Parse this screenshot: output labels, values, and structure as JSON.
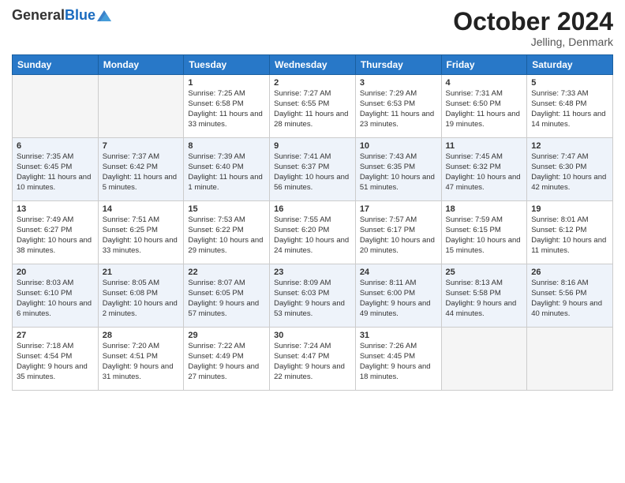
{
  "header": {
    "logo_general": "General",
    "logo_blue": "Blue",
    "month_title": "October 2024",
    "location": "Jelling, Denmark"
  },
  "weekdays": [
    "Sunday",
    "Monday",
    "Tuesday",
    "Wednesday",
    "Thursday",
    "Friday",
    "Saturday"
  ],
  "weeks": [
    [
      {
        "day": "",
        "sunrise": "",
        "sunset": "",
        "daylight": ""
      },
      {
        "day": "",
        "sunrise": "",
        "sunset": "",
        "daylight": ""
      },
      {
        "day": "1",
        "sunrise": "Sunrise: 7:25 AM",
        "sunset": "Sunset: 6:58 PM",
        "daylight": "Daylight: 11 hours and 33 minutes."
      },
      {
        "day": "2",
        "sunrise": "Sunrise: 7:27 AM",
        "sunset": "Sunset: 6:55 PM",
        "daylight": "Daylight: 11 hours and 28 minutes."
      },
      {
        "day": "3",
        "sunrise": "Sunrise: 7:29 AM",
        "sunset": "Sunset: 6:53 PM",
        "daylight": "Daylight: 11 hours and 23 minutes."
      },
      {
        "day": "4",
        "sunrise": "Sunrise: 7:31 AM",
        "sunset": "Sunset: 6:50 PM",
        "daylight": "Daylight: 11 hours and 19 minutes."
      },
      {
        "day": "5",
        "sunrise": "Sunrise: 7:33 AM",
        "sunset": "Sunset: 6:48 PM",
        "daylight": "Daylight: 11 hours and 14 minutes."
      }
    ],
    [
      {
        "day": "6",
        "sunrise": "Sunrise: 7:35 AM",
        "sunset": "Sunset: 6:45 PM",
        "daylight": "Daylight: 11 hours and 10 minutes."
      },
      {
        "day": "7",
        "sunrise": "Sunrise: 7:37 AM",
        "sunset": "Sunset: 6:42 PM",
        "daylight": "Daylight: 11 hours and 5 minutes."
      },
      {
        "day": "8",
        "sunrise": "Sunrise: 7:39 AM",
        "sunset": "Sunset: 6:40 PM",
        "daylight": "Daylight: 11 hours and 1 minute."
      },
      {
        "day": "9",
        "sunrise": "Sunrise: 7:41 AM",
        "sunset": "Sunset: 6:37 PM",
        "daylight": "Daylight: 10 hours and 56 minutes."
      },
      {
        "day": "10",
        "sunrise": "Sunrise: 7:43 AM",
        "sunset": "Sunset: 6:35 PM",
        "daylight": "Daylight: 10 hours and 51 minutes."
      },
      {
        "day": "11",
        "sunrise": "Sunrise: 7:45 AM",
        "sunset": "Sunset: 6:32 PM",
        "daylight": "Daylight: 10 hours and 47 minutes."
      },
      {
        "day": "12",
        "sunrise": "Sunrise: 7:47 AM",
        "sunset": "Sunset: 6:30 PM",
        "daylight": "Daylight: 10 hours and 42 minutes."
      }
    ],
    [
      {
        "day": "13",
        "sunrise": "Sunrise: 7:49 AM",
        "sunset": "Sunset: 6:27 PM",
        "daylight": "Daylight: 10 hours and 38 minutes."
      },
      {
        "day": "14",
        "sunrise": "Sunrise: 7:51 AM",
        "sunset": "Sunset: 6:25 PM",
        "daylight": "Daylight: 10 hours and 33 minutes."
      },
      {
        "day": "15",
        "sunrise": "Sunrise: 7:53 AM",
        "sunset": "Sunset: 6:22 PM",
        "daylight": "Daylight: 10 hours and 29 minutes."
      },
      {
        "day": "16",
        "sunrise": "Sunrise: 7:55 AM",
        "sunset": "Sunset: 6:20 PM",
        "daylight": "Daylight: 10 hours and 24 minutes."
      },
      {
        "day": "17",
        "sunrise": "Sunrise: 7:57 AM",
        "sunset": "Sunset: 6:17 PM",
        "daylight": "Daylight: 10 hours and 20 minutes."
      },
      {
        "day": "18",
        "sunrise": "Sunrise: 7:59 AM",
        "sunset": "Sunset: 6:15 PM",
        "daylight": "Daylight: 10 hours and 15 minutes."
      },
      {
        "day": "19",
        "sunrise": "Sunrise: 8:01 AM",
        "sunset": "Sunset: 6:12 PM",
        "daylight": "Daylight: 10 hours and 11 minutes."
      }
    ],
    [
      {
        "day": "20",
        "sunrise": "Sunrise: 8:03 AM",
        "sunset": "Sunset: 6:10 PM",
        "daylight": "Daylight: 10 hours and 6 minutes."
      },
      {
        "day": "21",
        "sunrise": "Sunrise: 8:05 AM",
        "sunset": "Sunset: 6:08 PM",
        "daylight": "Daylight: 10 hours and 2 minutes."
      },
      {
        "day": "22",
        "sunrise": "Sunrise: 8:07 AM",
        "sunset": "Sunset: 6:05 PM",
        "daylight": "Daylight: 9 hours and 57 minutes."
      },
      {
        "day": "23",
        "sunrise": "Sunrise: 8:09 AM",
        "sunset": "Sunset: 6:03 PM",
        "daylight": "Daylight: 9 hours and 53 minutes."
      },
      {
        "day": "24",
        "sunrise": "Sunrise: 8:11 AM",
        "sunset": "Sunset: 6:00 PM",
        "daylight": "Daylight: 9 hours and 49 minutes."
      },
      {
        "day": "25",
        "sunrise": "Sunrise: 8:13 AM",
        "sunset": "Sunset: 5:58 PM",
        "daylight": "Daylight: 9 hours and 44 minutes."
      },
      {
        "day": "26",
        "sunrise": "Sunrise: 8:16 AM",
        "sunset": "Sunset: 5:56 PM",
        "daylight": "Daylight: 9 hours and 40 minutes."
      }
    ],
    [
      {
        "day": "27",
        "sunrise": "Sunrise: 7:18 AM",
        "sunset": "Sunset: 4:54 PM",
        "daylight": "Daylight: 9 hours and 35 minutes."
      },
      {
        "day": "28",
        "sunrise": "Sunrise: 7:20 AM",
        "sunset": "Sunset: 4:51 PM",
        "daylight": "Daylight: 9 hours and 31 minutes."
      },
      {
        "day": "29",
        "sunrise": "Sunrise: 7:22 AM",
        "sunset": "Sunset: 4:49 PM",
        "daylight": "Daylight: 9 hours and 27 minutes."
      },
      {
        "day": "30",
        "sunrise": "Sunrise: 7:24 AM",
        "sunset": "Sunset: 4:47 PM",
        "daylight": "Daylight: 9 hours and 22 minutes."
      },
      {
        "day": "31",
        "sunrise": "Sunrise: 7:26 AM",
        "sunset": "Sunset: 4:45 PM",
        "daylight": "Daylight: 9 hours and 18 minutes."
      },
      {
        "day": "",
        "sunrise": "",
        "sunset": "",
        "daylight": ""
      },
      {
        "day": "",
        "sunrise": "",
        "sunset": "",
        "daylight": ""
      }
    ]
  ]
}
